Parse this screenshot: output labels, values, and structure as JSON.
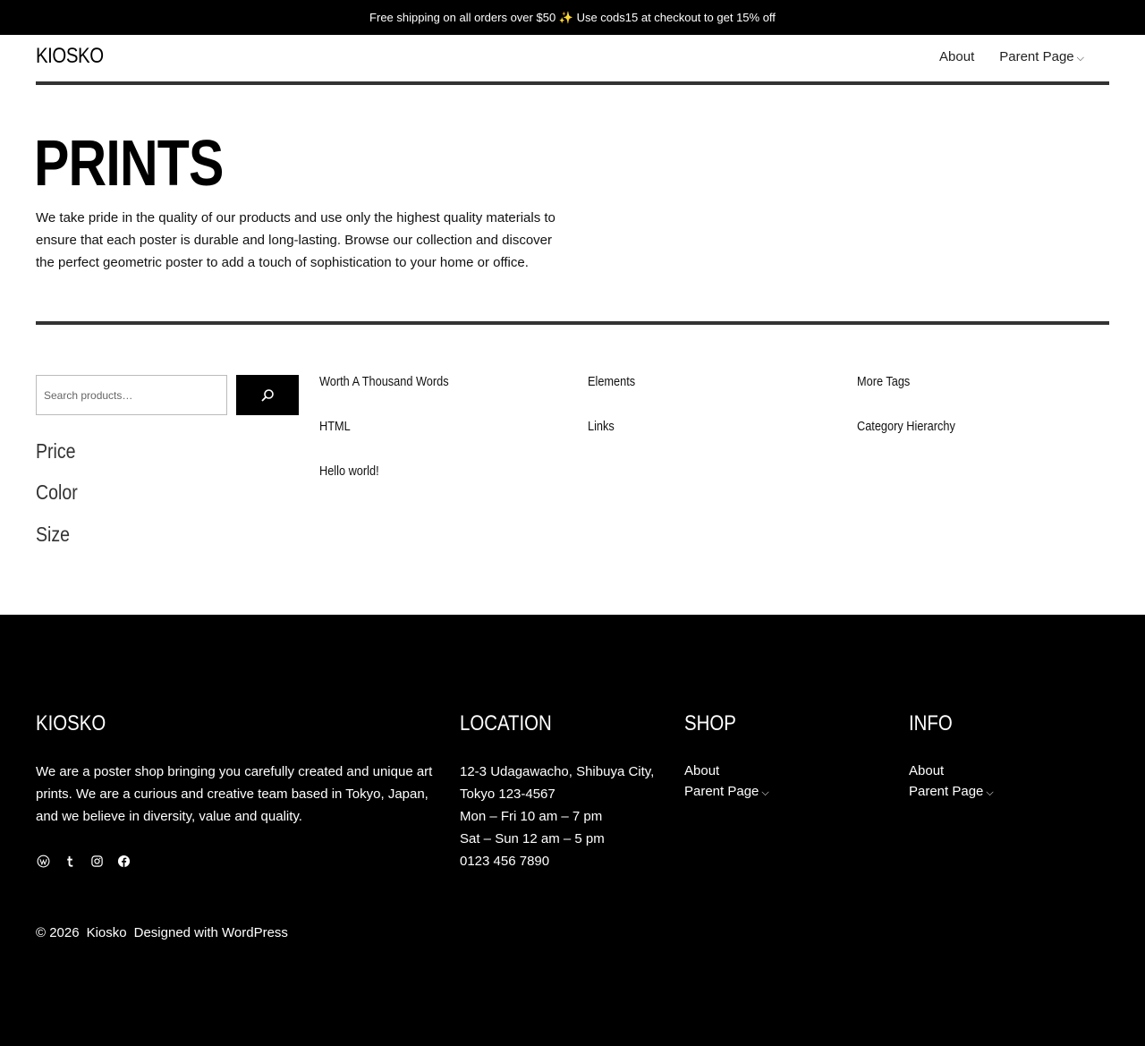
{
  "topbar": {
    "text": "Free shipping on all orders over $50 ✨ Use cods15 at checkout to get 15% off"
  },
  "header": {
    "logo": "KIOSKO",
    "nav": [
      {
        "label": "About"
      },
      {
        "label": "Parent Page",
        "has_dropdown": true
      }
    ]
  },
  "hero": {
    "title": "PRINTS",
    "description": "We take pride in the quality of our products and use only the highest quality materials to ensure that each poster is durable and long-lasting. Browse our collection and discover the perfect geometric poster to add a touch of sophistication to your home or office."
  },
  "search": {
    "placeholder": "Search products…",
    "icon": "search-icon"
  },
  "filters": [
    "Price",
    "Color",
    "Size"
  ],
  "posts": [
    "Worth A Thousand Words",
    "Elements",
    "More Tags",
    "HTML",
    "Links",
    "Category Hierarchy",
    "Hello world!"
  ],
  "footer": {
    "brand": "KIOSKO",
    "about": "We are a poster shop bringing you carefully created and unique art prints. We are a curious and creative team based in Tokyo, Japan, and we believe in diversity, value and quality.",
    "social": [
      "wordpress-icon",
      "tumblr-icon",
      "instagram-icon",
      "facebook-icon"
    ],
    "location": {
      "heading": "LOCATION",
      "lines": [
        "12-3 Udagawacho, Shibuya City,",
        "Tokyo 123-4567",
        "Mon – Fri 10 am – 7 pm",
        "Sat – Sun 12 am – 5 pm",
        "0123 456 7890"
      ]
    },
    "shop": {
      "heading": "SHOP",
      "links": [
        "About",
        "Parent Page"
      ]
    },
    "info": {
      "heading": "INFO",
      "links": [
        "About",
        "Parent Page"
      ]
    },
    "copyright": {
      "year": "© 2026",
      "name": "Kiosko",
      "credit": "Designed with WordPress"
    }
  },
  "colors": {
    "background": "#ffffff",
    "footer_bg": "#000000",
    "divider": "#333333",
    "text": "#000000"
  }
}
